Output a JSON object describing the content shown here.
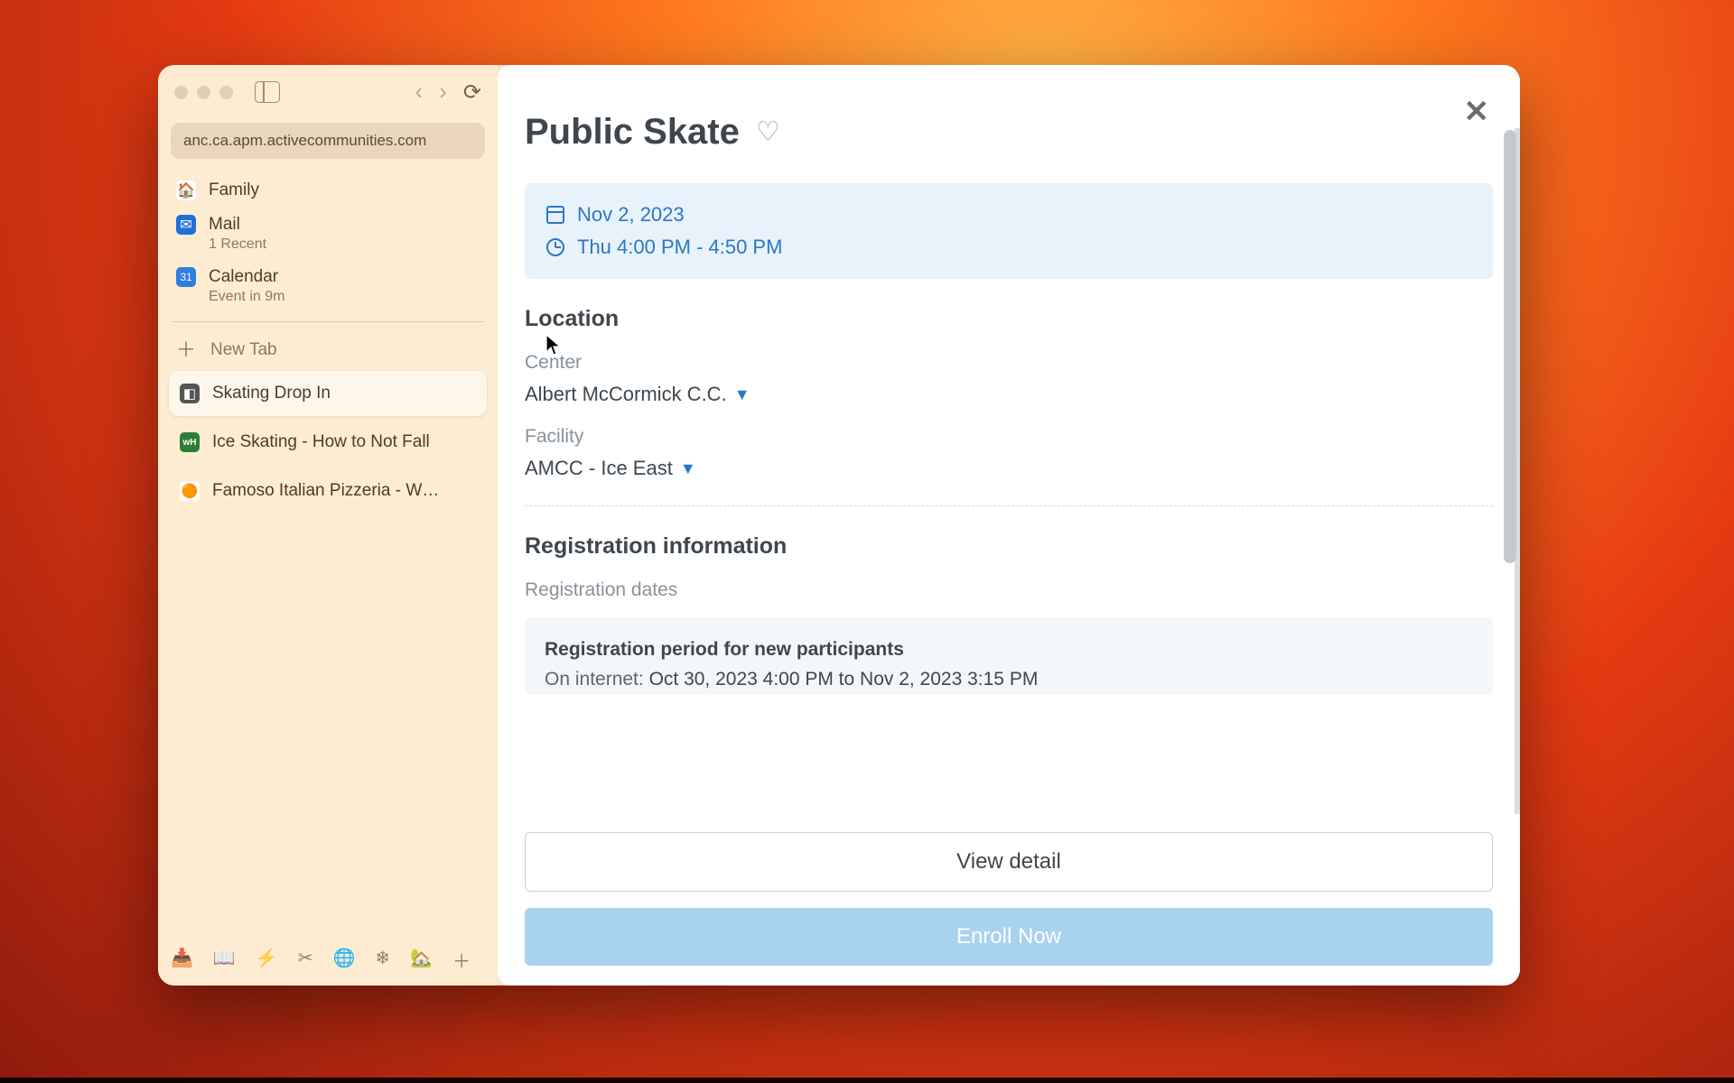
{
  "address_bar": "anc.ca.apm.activecommunities.com",
  "sidebar": {
    "pins": [
      {
        "title": "Family",
        "sub": null,
        "fav_bg": "#fff",
        "fav_glyph": "🏠"
      },
      {
        "title": "Mail",
        "sub": "1 Recent",
        "fav_bg": "#1f6fd6",
        "fav_glyph": "✉"
      },
      {
        "title": "Calendar",
        "sub": "Event in 9m",
        "fav_bg": "#2f7de0",
        "fav_glyph": "📅"
      }
    ],
    "new_tab_label": "New Tab",
    "tabs": [
      {
        "label": "Skating Drop In",
        "active": true,
        "fav_bg": "#555",
        "fav_glyph": "⛸"
      },
      {
        "label": "Ice Skating - How to Not Fall",
        "active": false,
        "fav_bg": "#2e7d32",
        "fav_glyph": "wH"
      },
      {
        "label": "Famoso Italian Pizzeria - W…",
        "active": false,
        "fav_bg": "#fff",
        "fav_glyph": "🟡"
      }
    ]
  },
  "page": {
    "title": "Public Skate",
    "date": "Nov 2, 2023",
    "time": "Thu 4:00 PM - 4:50 PM",
    "location_heading": "Location",
    "center_label": "Center",
    "center_value": "Albert McCormick C.C.",
    "facility_label": "Facility",
    "facility_value": "AMCC - Ice East",
    "reg_heading": "Registration information",
    "reg_dates_label": "Registration dates",
    "reg_period_title": "Registration period for new participants",
    "reg_internet_prefix": "On internet: ",
    "reg_internet_range": "Oct 30, 2023 4:00 PM to Nov 2, 2023 3:15 PM",
    "view_detail_label": "View detail",
    "enroll_label": "Enroll Now"
  }
}
